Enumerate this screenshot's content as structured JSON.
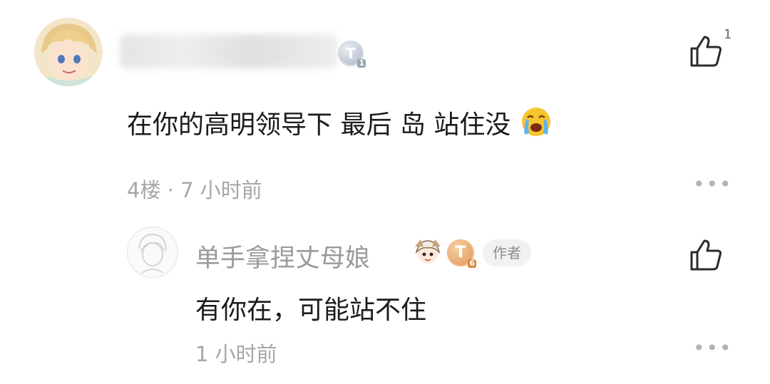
{
  "comment": {
    "level_badge": "T",
    "level_num": "1",
    "text": "在你的高明领导下 最后 岛 站住没",
    "emoji": "loudly-crying-face",
    "meta": "4楼 · 7 小时前",
    "like_count": "1"
  },
  "reply": {
    "username": "单手拿捏丈母娘",
    "level_badge": "T",
    "level_num": "6",
    "author_tag": "作者",
    "text": "有你在，可能站不住",
    "meta": "1 小时前"
  },
  "icons": {
    "like": "thumbs-up-icon",
    "more": "more-dots-icon"
  }
}
